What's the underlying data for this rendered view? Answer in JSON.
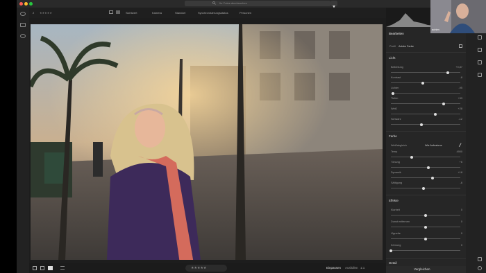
{
  "window": {
    "traffic": [
      "#ff5f57",
      "#febc2e",
      "#28c840"
    ]
  },
  "search": {
    "placeholder": "Ihr Fotos durchsuchen"
  },
  "filterbar": {
    "count": "2",
    "stars": "★★★★★",
    "filters": [
      "Sichtwert",
      "Kamera",
      "Standort",
      "Synchronisierungsstatus",
      "Personen"
    ]
  },
  "edit_panel": {
    "title": "Bearbeiten",
    "profile_label": "Profil",
    "profile_value": "Adobe Farbe",
    "light": {
      "header": "Licht",
      "sliders": [
        {
          "label": "Belichtung",
          "value": "+0,87",
          "pos": 0.82
        },
        {
          "label": "Kontrast",
          "value": "-8",
          "pos": 0.46
        },
        {
          "label": "Lichter",
          "value": "-95",
          "pos": 0.03
        },
        {
          "label": "Tiefen",
          "value": "+53",
          "pos": 0.76
        },
        {
          "label": "Weiß",
          "value": "+28",
          "pos": 0.64
        },
        {
          "label": "Schwarz",
          "value": "-12",
          "pos": 0.44
        }
      ]
    },
    "color": {
      "header": "Farbe",
      "wb_label": "Weißabgleich",
      "wb_value": "Wie Aufnahme",
      "sliders": [
        {
          "label": "Temp",
          "value": "4900",
          "pos": 0.3
        },
        {
          "label": "Tönung",
          "value": "+6",
          "pos": 0.54
        },
        {
          "label": "Dynamik",
          "value": "+18",
          "pos": 0.6
        },
        {
          "label": "Sättigung",
          "value": "-6",
          "pos": 0.47
        }
      ]
    },
    "effects": {
      "header": "Effekte",
      "sliders": [
        {
          "label": "Klarheit",
          "value": "0",
          "pos": 0.5
        },
        {
          "label": "Dunst entfernen",
          "value": "0",
          "pos": 0.5
        },
        {
          "label": "Vignette",
          "value": "0",
          "pos": 0.5
        },
        {
          "label": "Körnung",
          "value": "0",
          "pos": 0.0
        }
      ]
    },
    "detail_header": "Detail"
  },
  "bottombar": {
    "fit_label": "Einpassen",
    "fill_label": "Ausfüllen",
    "ratio_label": "1:1",
    "stars": "★★★★★",
    "versions_label": "Vergleichen"
  },
  "webcam": {
    "caption": "achim"
  }
}
